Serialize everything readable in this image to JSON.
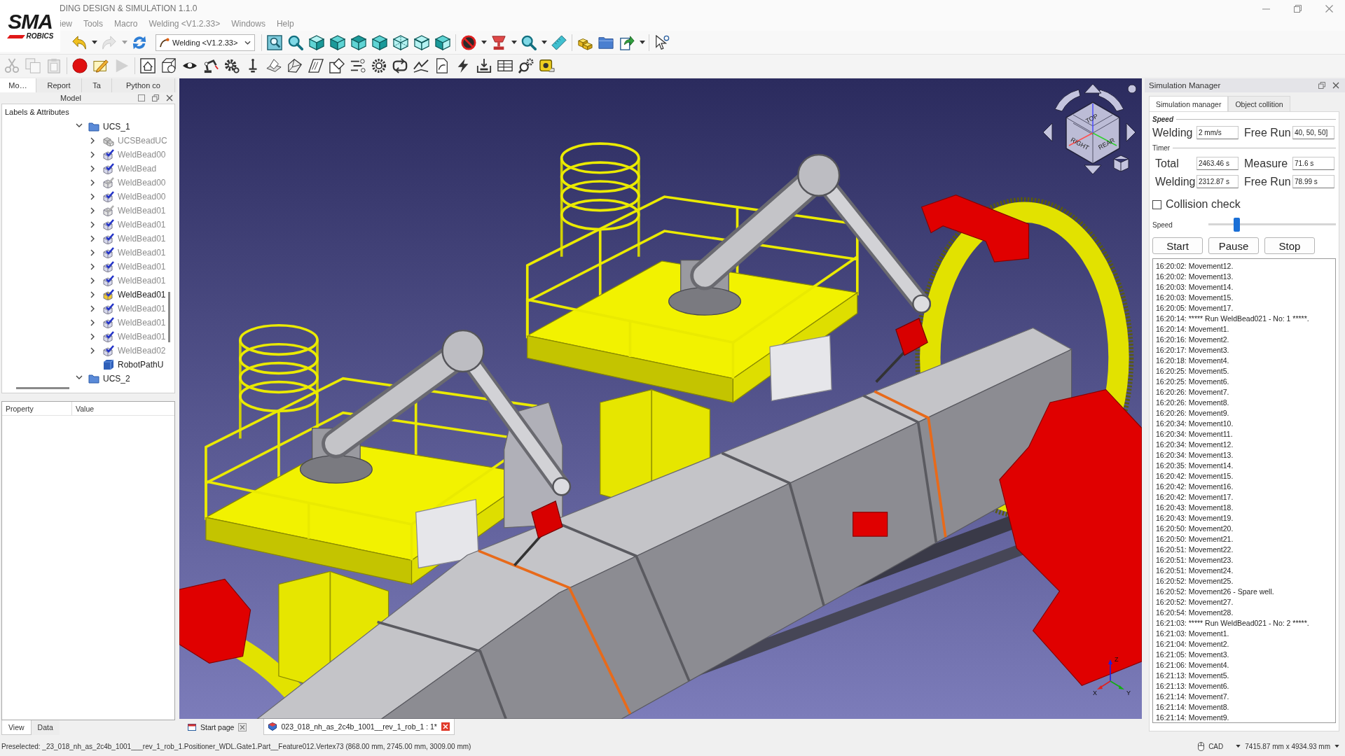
{
  "window": {
    "title": "DING DESIGN & SIMULATION 1.1.0"
  },
  "logo": {
    "wordmark": "SMA",
    "subtitle": "ROBICS"
  },
  "menu": [
    "iew",
    "Tools",
    "Macro",
    "Welding <V1.2.33>",
    "Windows",
    "Help"
  ],
  "toolbar_1": {
    "groups": [
      {
        "items": [
          {
            "kind": "undo",
            "disabled": false
          },
          {
            "kind": "caret",
            "disabled": false
          },
          {
            "kind": "redo",
            "disabled": true
          },
          {
            "kind": "caret",
            "disabled": true
          },
          {
            "kind": "refresh",
            "disabled": false
          },
          {
            "kind": "combo",
            "value": "Welding <V1.2.33>",
            "disabled": false
          }
        ]
      },
      {
        "items": [
          {
            "kind": "fit",
            "disabled": false
          },
          {
            "kind": "zoom",
            "disabled": false
          },
          {
            "kind": "isometric",
            "disabled": false
          },
          {
            "kind": "front",
            "disabled": false
          },
          {
            "kind": "top",
            "disabled": false
          },
          {
            "kind": "right",
            "disabled": false
          },
          {
            "kind": "rear",
            "disabled": false
          },
          {
            "kind": "bottom",
            "disabled": false
          },
          {
            "kind": "left",
            "disabled": false
          }
        ]
      },
      {
        "items": [
          {
            "kind": "prohibited",
            "disabled": false
          },
          {
            "kind": "caret",
            "disabled": false
          },
          {
            "kind": "pedestal",
            "disabled": false
          },
          {
            "kind": "caret",
            "disabled": false
          },
          {
            "kind": "zoom",
            "disabled": false
          },
          {
            "kind": "caret",
            "disabled": false
          },
          {
            "kind": "ruler",
            "disabled": false
          }
        ]
      },
      {
        "items": [
          {
            "kind": "blocks",
            "disabled": false
          },
          {
            "kind": "folder",
            "disabled": false
          },
          {
            "kind": "export",
            "disabled": false
          },
          {
            "kind": "caret",
            "disabled": false
          }
        ]
      },
      {
        "items": [
          {
            "kind": "cursor",
            "disabled": false
          }
        ]
      }
    ]
  },
  "toolbar_2": {
    "groups": [
      {
        "items": [
          {
            "kind": "scissors",
            "disabled": true
          },
          {
            "kind": "copy",
            "disabled": true
          },
          {
            "kind": "paste",
            "disabled": true
          }
        ]
      },
      {
        "items": [
          {
            "kind": "record",
            "disabled": false
          },
          {
            "kind": "pencil",
            "disabled": false
          },
          {
            "kind": "play",
            "disabled": true
          }
        ]
      },
      {
        "items": [
          {
            "kind": "house",
            "disabled": false
          },
          {
            "kind": "cubenum",
            "disabled": false
          },
          {
            "kind": "eye",
            "disabled": false
          },
          {
            "kind": "robot",
            "disabled": false
          },
          {
            "kind": "gear",
            "disabled": false
          },
          {
            "kind": "torch",
            "disabled": false
          },
          {
            "kind": "planes",
            "disabled": false
          },
          {
            "kind": "bevel",
            "disabled": false
          },
          {
            "kind": "slanted",
            "disabled": false
          },
          {
            "kind": "diamond",
            "disabled": false
          },
          {
            "kind": "list",
            "disabled": false
          },
          {
            "kind": "sprocket",
            "disabled": false
          },
          {
            "kind": "loop",
            "disabled": false
          },
          {
            "kind": "zigzag",
            "disabled": false
          },
          {
            "kind": "page",
            "disabled": false
          },
          {
            "kind": "bolt",
            "disabled": false
          },
          {
            "kind": "tray",
            "disabled": false
          },
          {
            "kind": "table",
            "disabled": false
          },
          {
            "kind": "findgear",
            "disabled": false
          },
          {
            "kind": "tape",
            "disabled": false
          }
        ]
      }
    ]
  },
  "left_panel": {
    "tabs": [
      {
        "label": "Mo…",
        "selected": true
      },
      {
        "label": "Report",
        "selected": false
      },
      {
        "label": "Ta",
        "selected": false
      },
      {
        "label": "Python co",
        "selected": false
      }
    ],
    "title": "Model",
    "tree_title": "Labels & Attributes",
    "tree": [
      {
        "label": "UCS_1",
        "kind": "folder",
        "expanded": true,
        "children": [
          {
            "label": "UCSBeadUC",
            "kind": "ucsbead",
            "expanded": false,
            "active": false,
            "highlighted": false
          },
          {
            "label": "WeldBead00",
            "kind": "bead",
            "expanded": false,
            "active": true,
            "highlighted": false
          },
          {
            "label": "WeldBead",
            "kind": "bead",
            "expanded": false,
            "active": true,
            "highlighted": false
          },
          {
            "label": "WeldBead00",
            "kind": "bead",
            "expanded": false,
            "active": false,
            "highlighted": false
          },
          {
            "label": "WeldBead00",
            "kind": "bead",
            "expanded": false,
            "active": true,
            "highlighted": false
          },
          {
            "label": "WeldBead01",
            "kind": "bead",
            "expanded": false,
            "active": false,
            "highlighted": false
          },
          {
            "label": "WeldBead01",
            "kind": "bead",
            "expanded": false,
            "active": true,
            "highlighted": false
          },
          {
            "label": "WeldBead01",
            "kind": "bead",
            "expanded": false,
            "active": true,
            "highlighted": false
          },
          {
            "label": "WeldBead01",
            "kind": "bead",
            "expanded": false,
            "active": true,
            "highlighted": false
          },
          {
            "label": "WeldBead01",
            "kind": "bead",
            "expanded": false,
            "active": true,
            "highlighted": false
          },
          {
            "label": "WeldBead01",
            "kind": "bead",
            "expanded": false,
            "active": true,
            "highlighted": false
          },
          {
            "label": "WeldBead01",
            "kind": "bead",
            "expanded": false,
            "active": true,
            "highlighted": true
          },
          {
            "label": "WeldBead01",
            "kind": "bead",
            "expanded": false,
            "active": true,
            "highlighted": false
          },
          {
            "label": "WeldBead01",
            "kind": "bead",
            "expanded": false,
            "active": true,
            "highlighted": false
          },
          {
            "label": "WeldBead01",
            "kind": "bead",
            "expanded": false,
            "active": true,
            "highlighted": false
          },
          {
            "label": "WeldBead02",
            "kind": "bead",
            "expanded": false,
            "active": true,
            "highlighted": false
          },
          {
            "label": "RobotPathU",
            "kind": "path",
            "active": true,
            "highlighted": false
          }
        ]
      },
      {
        "label": "UCS_2",
        "kind": "folder",
        "expanded": true
      }
    ]
  },
  "property_view": {
    "columns": [
      "Property",
      "Value"
    ],
    "tabs": [
      {
        "label": "View",
        "selected": true
      },
      {
        "label": "Data",
        "selected": false
      }
    ]
  },
  "viewport": {
    "navigation_cube": {
      "faces": [
        "TOP",
        "RIGHT",
        "REAR"
      ]
    },
    "axes": [
      "Z",
      "X",
      "Y"
    ]
  },
  "document_tabs": [
    {
      "kind": "start",
      "label": "Start page",
      "selected": false
    },
    {
      "kind": "document",
      "label": "023_018_nh_as_2c4b_1001__rev_1_rob_1 : 1*",
      "selected": true
    }
  ],
  "simulation_manager": {
    "title": "Simulation Manager",
    "tabs": [
      {
        "label": "Simulation manager",
        "selected": true
      },
      {
        "label": "Object collition",
        "selected": false
      }
    ],
    "speed": {
      "title": "Speed",
      "fields": [
        {
          "label": "Welding",
          "value": "2 mm/s"
        },
        {
          "label": "Free Run",
          "value": "40, 50, 50]"
        }
      ]
    },
    "timer": {
      "title": "Timer",
      "fields": [
        {
          "label": "Total",
          "value": "2463.46 s"
        },
        {
          "label": "Measure",
          "value": "71.6 s"
        },
        {
          "label": "Welding",
          "value": "2312.87 s"
        },
        {
          "label": "Free Run",
          "value": "78.99 s"
        }
      ]
    },
    "collision_check": {
      "label": "Collision check",
      "checked": false
    },
    "speed_slider": {
      "label": "Speed",
      "level": 0.21
    },
    "buttons": [
      "Start",
      "Pause",
      "Stop"
    ],
    "log": [
      "16:20:02: Movement12.",
      "16:20:02: Movement13.",
      "16:20:03: Movement14.",
      "16:20:03: Movement15.",
      "16:20:05: Movement17.",
      "16:20:14: ***** Run WeldBead021 - No: 1 *****.",
      "16:20:14: Movement1.",
      "16:20:16: Movement2.",
      "16:20:17: Movement3.",
      "16:20:18: Movement4.",
      "16:20:25: Movement5.",
      "16:20:25: Movement6.",
      "16:20:26: Movement7.",
      "16:20:26: Movement8.",
      "16:20:26: Movement9.",
      "16:20:34: Movement10.",
      "16:20:34: Movement11.",
      "16:20:34: Movement12.",
      "16:20:34: Movement13.",
      "16:20:35: Movement14.",
      "16:20:42: Movement15.",
      "16:20:42: Movement16.",
      "16:20:42: Movement17.",
      "16:20:43: Movement18.",
      "16:20:43: Movement19.",
      "16:20:50: Movement20.",
      "16:20:50: Movement21.",
      "16:20:51: Movement22.",
      "16:20:51: Movement23.",
      "16:20:51: Movement24.",
      "16:20:52: Movement25.",
      "16:20:52: Movement26 - Spare well.",
      "16:20:52: Movement27.",
      "16:20:54: Movement28.",
      "16:21:03: ***** Run WeldBead021 - No: 2 *****.",
      "16:21:03: Movement1.",
      "16:21:04: Movement2.",
      "16:21:05: Movement3.",
      "16:21:06: Movement4.",
      "16:21:13: Movement5.",
      "16:21:13: Movement6.",
      "16:21:14: Movement7.",
      "16:21:14: Movement8.",
      "16:21:14: Movement9."
    ]
  },
  "status_bar": {
    "message": "Preselected: _23_018_nh_as_2c4b_1001___rev_1_rob_1.Positioner_WDL.Gate1.Part__Feature012.Vertex73 (868.00 mm, 2745.00 mm, 3009.00 mm)",
    "navigation_style": "CAD",
    "dimensions": "7415.87 mm x 4934.93 mm"
  }
}
